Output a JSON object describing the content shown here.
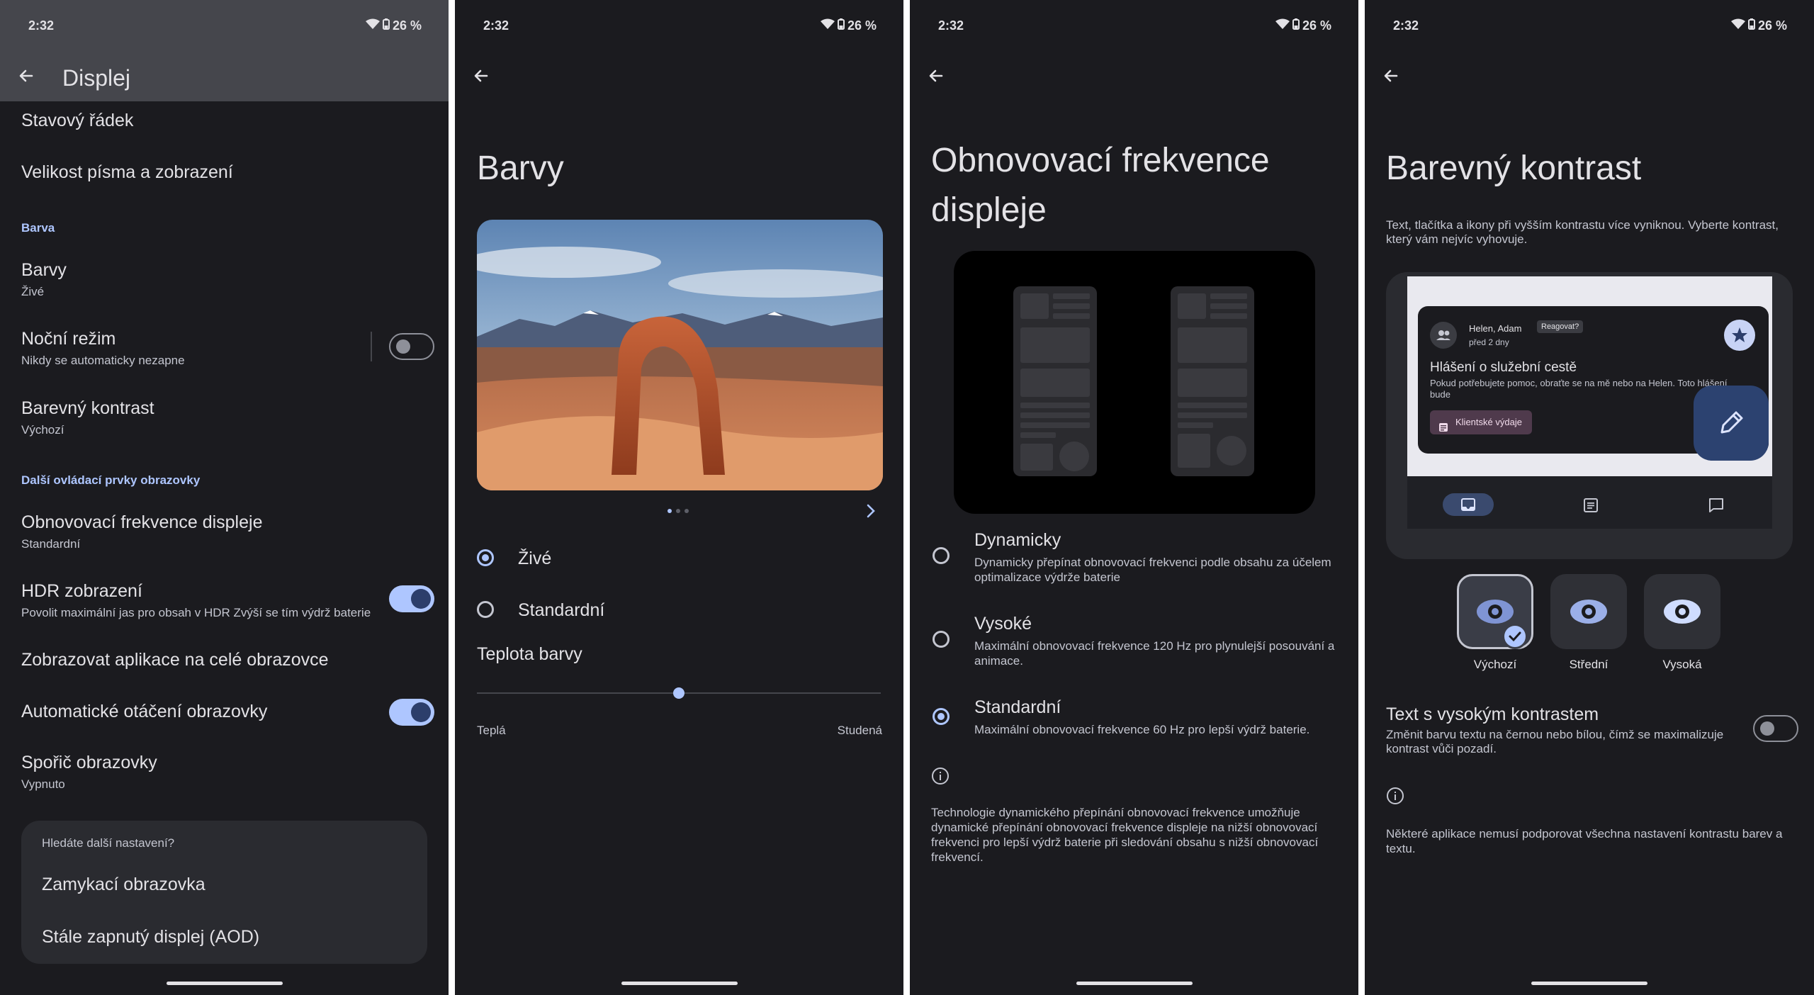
{
  "status": {
    "time": "2:32",
    "battery": "26 %"
  },
  "panel1": {
    "title": "Displej",
    "items_top": [
      {
        "title": "Stavový řádek"
      },
      {
        "title": "Velikost písma a zobrazení"
      }
    ],
    "section_color": "Barva",
    "colors": {
      "title": "Barvy",
      "sub": "Živé"
    },
    "night_mode": {
      "title": "Noční režim",
      "sub": "Nikdy se automaticky nezapne",
      "on": false
    },
    "contrast": {
      "title": "Barevný kontrast",
      "sub": "Výchozí"
    },
    "section_more": "Další ovládací prvky obrazovky",
    "refresh": {
      "title": "Obnovovací frekvence displeje",
      "sub": "Standardní"
    },
    "hdr": {
      "title": "HDR zobrazení",
      "sub": "Povolit maximální jas pro obsah v HDR Zvýší se tím výdrž baterie",
      "on": true
    },
    "fullscreen": {
      "title": "Zobrazovat aplikace na celé obrazovce"
    },
    "autorotate": {
      "title": "Automatické otáčení obrazovky",
      "on": true
    },
    "screensaver": {
      "title": "Spořič obrazovky",
      "sub": "Vypnuto"
    },
    "card": {
      "heading": "Hledáte další nastavení?",
      "items": [
        "Zamykací obrazovka",
        "Stále zapnutý displej (AOD)"
      ]
    }
  },
  "panel2": {
    "title": "Barvy",
    "options": [
      "Živé",
      "Standardní"
    ],
    "selected": 0,
    "temperature_title": "Teplota barvy",
    "temperature_left": "Teplá",
    "temperature_right": "Studená",
    "temperature_value": 0.5
  },
  "panel3": {
    "title": "Obnovovací frekvence displeje",
    "options": [
      {
        "title": "Dynamicky",
        "desc": "Dynamicky přepínat obnovovací frekvenci podle obsahu za účelem optimalizace výdrže baterie"
      },
      {
        "title": "Vysoké",
        "desc": "Maximální obnovovací frekvence 120 Hz pro plynulejší posouvání a animace."
      },
      {
        "title": "Standardní",
        "desc": "Maximální obnovovací frekvence 60 Hz pro lepší výdrž baterie."
      }
    ],
    "selected": 2,
    "info": "Technologie dynamického přepínání obnovovací frekvence umožňuje dynamické přepínání obnovovací frekvence displeje na nižší obnovovací frekvenci pro lepší výdrž baterie při sledování obsahu s nižší obnovovací frekvencí."
  },
  "panel4": {
    "title": "Barevný kontrast",
    "intro": "Text, tlačítka a ikony při vyšším kontrastu více vyniknou. Vyberte kontrast, který vám nejvíc vyhovuje.",
    "preview": {
      "sender": "Helen, Adam",
      "chip": "Reagovat?",
      "time": "před 2 dny",
      "subject": "Hlášení o služební cestě",
      "body": "Pokud potřebujete pomoc, obraťte se na mě nebo na Helen. Toto hlášení bude",
      "attachment": "Klientské výdaje"
    },
    "levels": [
      "Výchozí",
      "Střední",
      "Vysoká"
    ],
    "selected": 0,
    "hc_text": {
      "title": "Text s vysokým kontrastem",
      "sub": "Změnit barvu textu na černou nebo bílou, čímž se maximalizuje kontrast vůči pozadí.",
      "on": false
    },
    "info": "Některé aplikace nemusí podporovat všechna nastavení kontrastu barev a textu."
  },
  "colors": {
    "accent": "#aec6ff",
    "bg": "#1b1b1f",
    "surface": "#2a2b30"
  }
}
